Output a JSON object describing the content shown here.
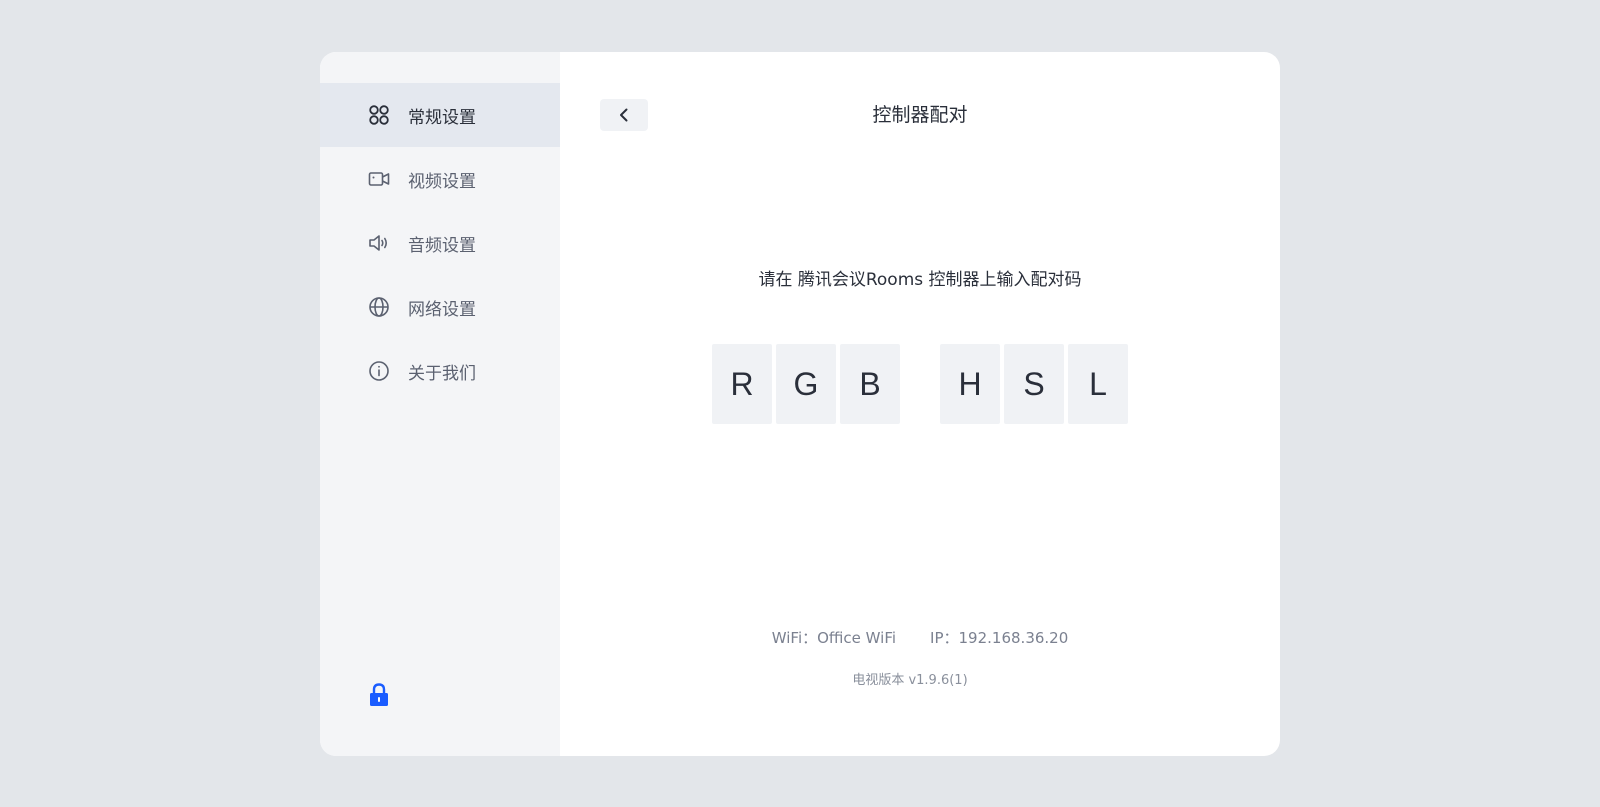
{
  "sidebar": {
    "items": [
      {
        "label": "常规设置",
        "icon": "grid-dots-icon",
        "active": true
      },
      {
        "label": "视频设置",
        "icon": "video-camera-icon",
        "active": false
      },
      {
        "label": "音频设置",
        "icon": "speaker-icon",
        "active": false
      },
      {
        "label": "网络设置",
        "icon": "globe-icon",
        "active": false
      },
      {
        "label": "关于我们",
        "icon": "info-icon",
        "active": false
      }
    ],
    "lock_icon": "lock-icon"
  },
  "main": {
    "back_icon": "chevron-left-icon",
    "title": "控制器配对",
    "instruction": "请在 腾讯会议Rooms 控制器上输入配对码",
    "code_groups": [
      [
        "R",
        "G",
        "B"
      ],
      [
        "H",
        "S",
        "L"
      ]
    ],
    "wifi": "WiFi：Office WiFi",
    "ip": "IP：192.168.36.20",
    "version": "电视版本 v1.9.6(1)"
  },
  "colors": {
    "background": "#e3e6ea",
    "sidebar_bg": "#f4f5f7",
    "active_item_bg": "#e4e8ef",
    "code_cell_bg": "#f0f2f5",
    "lock_accent": "#1a5cff"
  }
}
